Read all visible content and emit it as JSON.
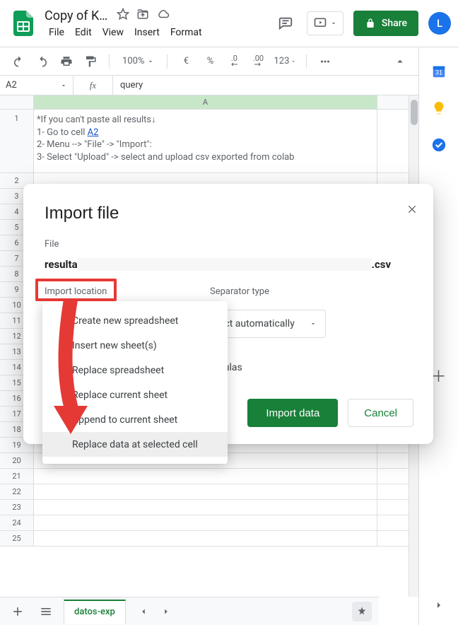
{
  "header": {
    "doc_title": "Copy of K…",
    "menus": [
      "File",
      "Edit",
      "View",
      "Insert",
      "Format"
    ],
    "share_label": "Share",
    "avatar_initial": "L"
  },
  "toolbar": {
    "zoom": "100%",
    "currency": "€",
    "percent": "%",
    "dec_minus": ".0",
    "dec_plus": ".00",
    "format123": "123"
  },
  "fxbar": {
    "name": "A2",
    "fx": "fx",
    "formula": "query"
  },
  "sheet": {
    "col_a_label": "A",
    "row1_text": "*If you can't paste all results↓\n1- Go to cell ",
    "row1_link_text": "A2",
    "row1_text_b": "\n2- Menu --> \"File\" -> \"Import\":\n3- Select \"Upload\" -> select and upload csv exported from colab",
    "tab_name": "datos-exp",
    "rows": [
      "1",
      "2",
      "3",
      "4",
      "5",
      "6",
      "7",
      "8",
      "9",
      "10",
      "11",
      "12",
      "13",
      "14",
      "15",
      "16",
      "17",
      "18",
      "19",
      "20",
      "21",
      "22",
      "23",
      "24",
      "25"
    ]
  },
  "dialog": {
    "title": "Import file",
    "file_label": "File",
    "filename_prefix": "resulta",
    "filename_suffix": ".csv",
    "import_location_label": "Import location",
    "separator_label": "Separator type",
    "separator_value": "ect automatically",
    "convert_text": "nd formulas",
    "import_btn": "Import data",
    "cancel_btn": "Cancel"
  },
  "dropdown": {
    "items": [
      "Create new spreadsheet",
      "Insert new sheet(s)",
      "Replace spreadsheet",
      "Replace current sheet",
      "Append to current sheet",
      "Replace data at selected cell"
    ]
  }
}
